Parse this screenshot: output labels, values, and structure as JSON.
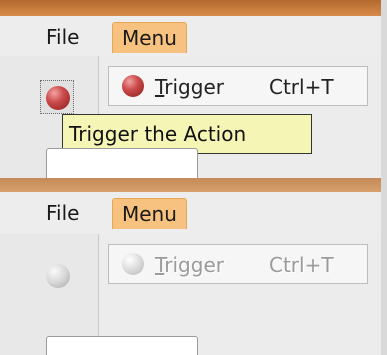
{
  "panels": [
    {
      "state": "enabled",
      "menubar": {
        "file": "File",
        "menu": "Menu"
      },
      "menu_item": {
        "mnemonic": "T",
        "label_rest": "rigger",
        "shortcut": "Ctrl+T"
      },
      "tooltip": "Trigger the Action",
      "icon": "red-ball-icon"
    },
    {
      "state": "disabled",
      "menubar": {
        "file": "File",
        "menu": "Menu"
      },
      "menu_item": {
        "mnemonic": "T",
        "label_rest": "rigger",
        "shortcut": "Ctrl+T"
      },
      "icon": "gray-ball-icon"
    }
  ],
  "colors": {
    "menu_highlight": "#f7c27f",
    "tooltip_bg": "#f5f5b5",
    "icon_red": "#cc4b4b",
    "icon_gray": "#d7d7d7"
  }
}
